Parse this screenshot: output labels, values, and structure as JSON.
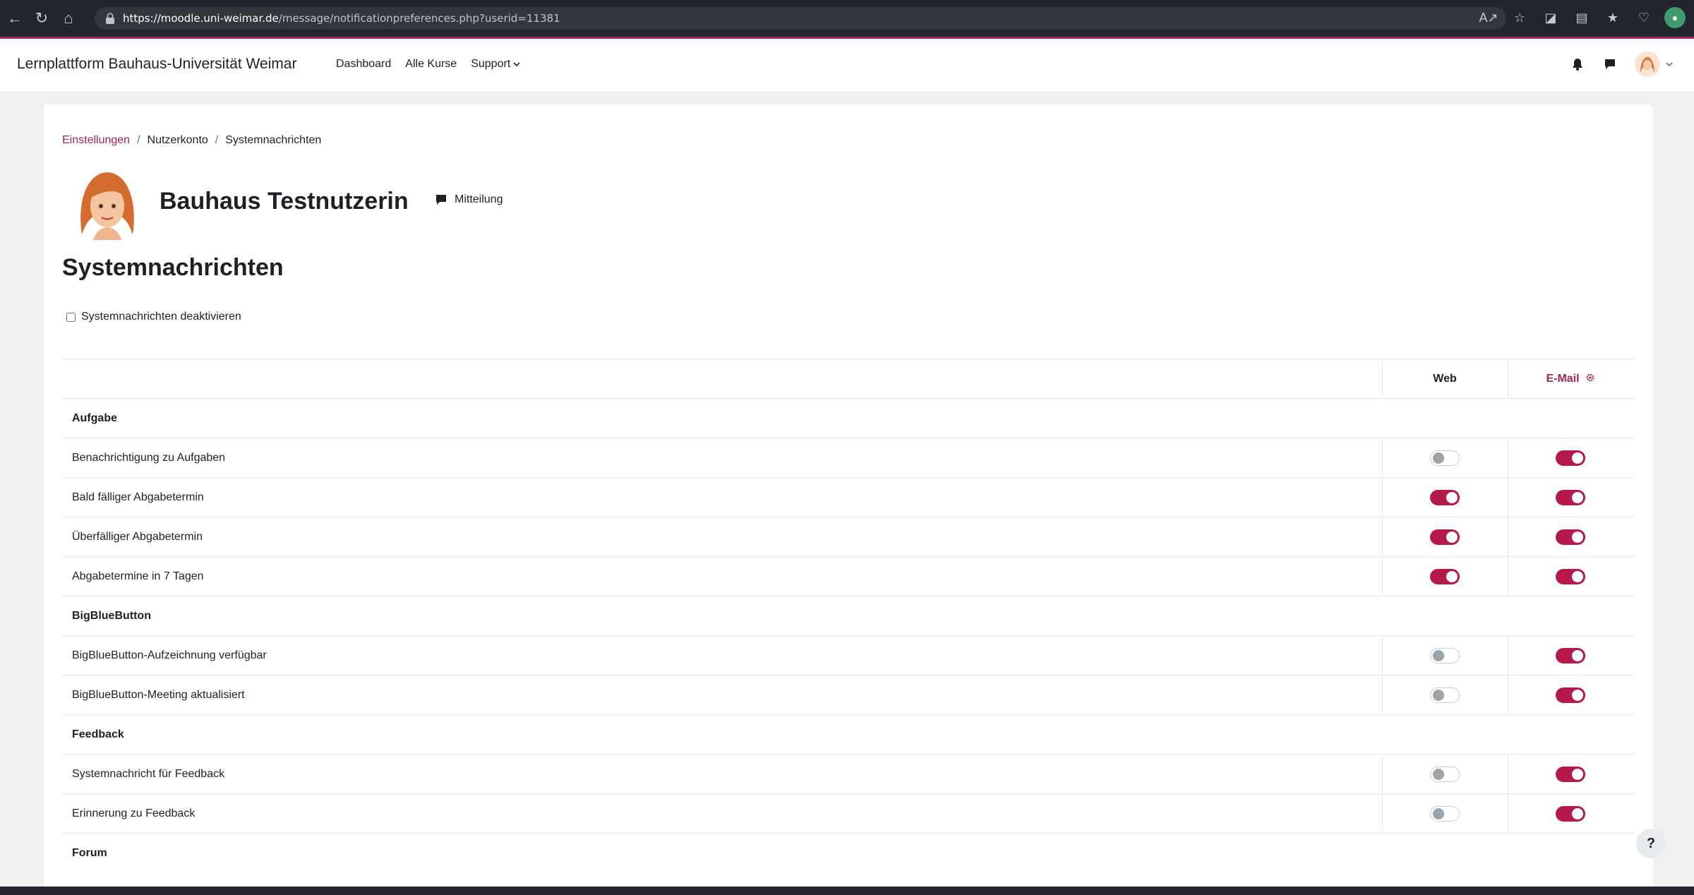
{
  "browser": {
    "url_host": "https://moodle.uni-weimar.de",
    "url_path": "/message/notificationpreferences.php?userid=11381"
  },
  "navbar": {
    "brand": "Lernplattform Bauhaus-Universität Weimar",
    "links": [
      "Dashboard",
      "Alle Kurse",
      "Support"
    ]
  },
  "breadcrumb": {
    "items": [
      "Einstellungen",
      "Nutzerkonto",
      "Systemnachrichten"
    ]
  },
  "profile": {
    "name": "Bauhaus Testnutzerin",
    "message_label": "Mitteilung"
  },
  "page": {
    "title": "Systemnachrichten",
    "disable_label": "Systemnachrichten deaktivieren"
  },
  "table": {
    "col_web": "Web",
    "col_mail": "E-Mail",
    "groups": [
      {
        "name": "Aufgabe",
        "rows": [
          {
            "label": "Benachrichtigung zu Aufgaben",
            "web": false,
            "mail": true
          },
          {
            "label": "Bald fälliger Abgabetermin",
            "web": true,
            "mail": true
          },
          {
            "label": "Überfälliger Abgabetermin",
            "web": true,
            "mail": true
          },
          {
            "label": "Abgabetermine in 7 Tagen",
            "web": true,
            "mail": true
          }
        ]
      },
      {
        "name": "BigBlueButton",
        "rows": [
          {
            "label": "BigBlueButton-Aufzeichnung verfügbar",
            "web": false,
            "mail": true
          },
          {
            "label": "BigBlueButton-Meeting aktualisiert",
            "web": false,
            "mail": true
          }
        ]
      },
      {
        "name": "Feedback",
        "rows": [
          {
            "label": "Systemnachricht für Feedback",
            "web": false,
            "mail": true
          },
          {
            "label": "Erinnerung zu Feedback",
            "web": false,
            "mail": true
          }
        ]
      },
      {
        "name": "Forum",
        "rows": []
      }
    ]
  },
  "help_label": "?",
  "colors": {
    "accent": "#a02752",
    "toggle_on": "#b4194a",
    "toggle_off_knob": "#9ca3a9"
  }
}
